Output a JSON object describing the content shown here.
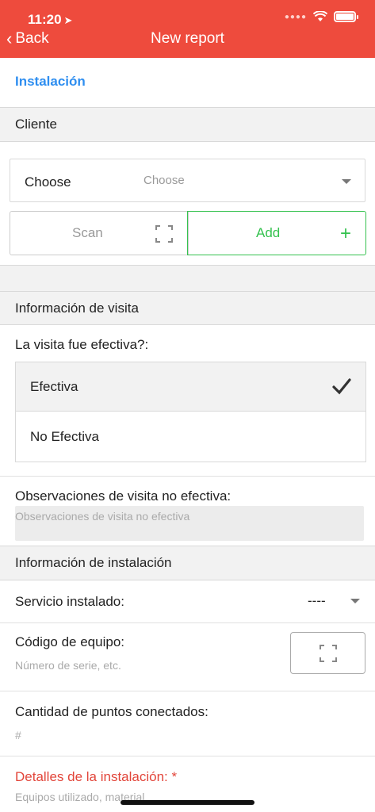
{
  "status": {
    "time": "11:20"
  },
  "nav": {
    "back_label": "Back",
    "title": "New report"
  },
  "tab": {
    "label": "Instalación"
  },
  "cliente": {
    "section_title": "Cliente",
    "select_label": "Choose",
    "select_placeholder": "Choose",
    "scan_label": "Scan",
    "add_label": "Add"
  },
  "visita": {
    "section_title": "Información de visita",
    "question": "La visita fue efectiva?:",
    "options": [
      {
        "label": "Efectiva",
        "selected": true
      },
      {
        "label": "No Efectiva",
        "selected": false
      }
    ],
    "obs_label": "Observaciones de visita no efectiva:",
    "obs_placeholder": "Observaciones de visita no efectiva"
  },
  "instalacion": {
    "section_title": "Información de instalación",
    "servicio_label": "Servicio instalado:",
    "servicio_value": "----",
    "codigo_label": "Código de equipo:",
    "codigo_placeholder": "Número de serie, etc.",
    "puntos_label": "Cantidad de puntos conectados:",
    "puntos_placeholder": "#",
    "detalles_label": "Detalles de la instalación: *",
    "detalles_placeholder": "Equipos utilizado, material"
  },
  "colors": {
    "header": "#ee4b3d",
    "link": "#2e8ef0",
    "add": "#35c24f",
    "required": "#e2453a"
  }
}
